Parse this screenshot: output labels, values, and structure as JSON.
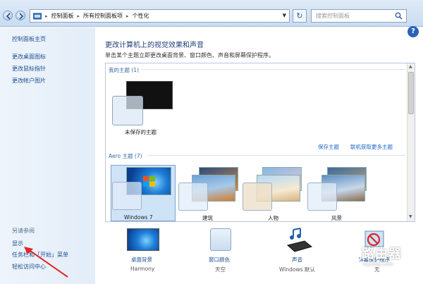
{
  "address_bar": {
    "crumbs": [
      "控制面板",
      "所有控制面板项",
      "个性化"
    ],
    "search_placeholder": "搜索控制面板"
  },
  "left_pane": {
    "links": [
      "控制面板主页",
      "更改桌面图标",
      "更改鼠标指针",
      "更改帐户图片"
    ],
    "see_also_heading": "另请参阅",
    "see_also": [
      "显示",
      "任务栏和「开始」菜单",
      "轻松访问中心"
    ]
  },
  "main": {
    "title": "更改计算机上的视觉效果和声音",
    "subtitle": "单击某个主题立即更改桌面背景、窗口颜色、声音和屏幕保护程序。",
    "my_themes_label": "我的主题 (1)",
    "unsaved_theme_label": "未保存的主题",
    "save_theme_link": "保存主题",
    "get_more_link": "联机获取更多主题",
    "aero_label": "Aero 主题 (7)",
    "aero_themes": [
      "Windows 7",
      "建筑",
      "人物",
      "风景"
    ]
  },
  "bottom": {
    "items": [
      {
        "label": "桌面背景",
        "value": "Harmony"
      },
      {
        "label": "窗口颜色",
        "value": "天空"
      },
      {
        "label": "声音",
        "value": "Windows 默认"
      },
      {
        "label": "屏幕保护程序",
        "value": "无"
      }
    ]
  },
  "watermark": {
    "text": "路由器",
    "sub": "luyouqi.com"
  },
  "colors": {
    "accent": "#1d4f91",
    "link": "#1d64c8",
    "help": "#2a64b9"
  }
}
